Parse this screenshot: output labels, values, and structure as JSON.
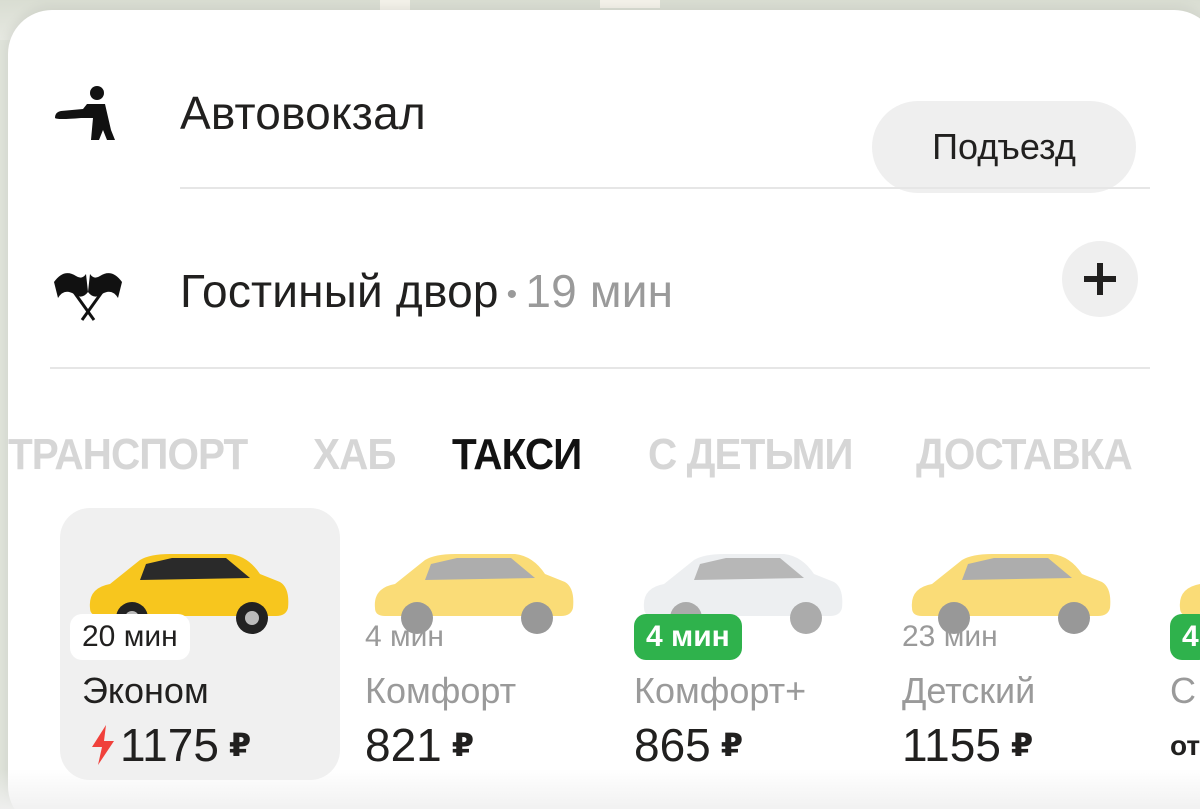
{
  "route": {
    "from": {
      "label": "Автовокзал",
      "icon": "pickup-person-icon",
      "entrance_button": "Подъезд"
    },
    "to": {
      "label": "Гостиный двор",
      "separator": "•",
      "eta": "19 мин",
      "icon": "finish-flags-icon",
      "add_button_icon": "plus-icon"
    }
  },
  "tabs": [
    {
      "label": "ТРАНСПОРТ",
      "active": false
    },
    {
      "label": "ХАБ",
      "active": false
    },
    {
      "label": "ТАКСИ",
      "active": true
    },
    {
      "label": "С ДЕТЬМИ",
      "active": false
    },
    {
      "label": "ДОСТАВКА",
      "active": false
    }
  ],
  "tariffs": [
    {
      "name": "Эконом",
      "eta": "20 мин",
      "price": "1175",
      "currency": "₽",
      "surge": true,
      "selected": true,
      "eta_style": "white",
      "car_color": "#f7c61e"
    },
    {
      "name": "Комфорт",
      "eta": "4 мин",
      "price": "821",
      "currency": "₽",
      "surge": false,
      "selected": false,
      "eta_style": "plain",
      "car_color": "#f8dc7a"
    },
    {
      "name": "Комфорт+",
      "eta": "4 мин",
      "price": "865",
      "currency": "₽",
      "surge": false,
      "selected": false,
      "eta_style": "green",
      "car_color": "#eef0f2"
    },
    {
      "name": "Детский",
      "eta": "23 мин",
      "price": "1155",
      "currency": "₽",
      "surge": false,
      "selected": false,
      "eta_style": "plain",
      "car_color": "#f8dc7a"
    },
    {
      "name": "С",
      "eta": "4",
      "price": "от",
      "currency": "",
      "surge": false,
      "selected": false,
      "eta_style": "green",
      "car_color": "#f8dc7a"
    }
  ],
  "colors": {
    "accent_green": "#2fb24c",
    "surge_red": "#f0413b",
    "taxi_yellow": "#f7c61e"
  }
}
